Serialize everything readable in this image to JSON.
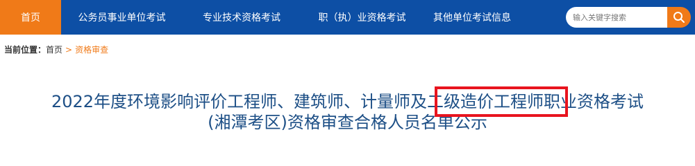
{
  "nav": {
    "items": [
      {
        "label": "首页",
        "active": true
      },
      {
        "label": "公务员事业单位考试",
        "active": false
      },
      {
        "label": "专业技术资格考试",
        "active": false
      },
      {
        "label": "职（执）业资格考试",
        "active": false
      },
      {
        "label": "其他单位考试信息",
        "active": false
      }
    ],
    "colors": {
      "bar": "#0d4fa5",
      "active": "#f07a18"
    }
  },
  "search": {
    "placeholder": "输入关键字搜索",
    "icon": "search-icon"
  },
  "breadcrumb": {
    "label": "当前位置：",
    "home": "首页",
    "separator": ">",
    "current": "资格审查"
  },
  "article": {
    "title_line1": "2022年度环境影响评价工程师、建筑师、计量师及二级造价工程师职业资格考试",
    "title_line2": "(湘潭考区)资格审查合格人员名单公示",
    "title_color": "#1d4f86",
    "highlight_color": "#e8141e"
  }
}
